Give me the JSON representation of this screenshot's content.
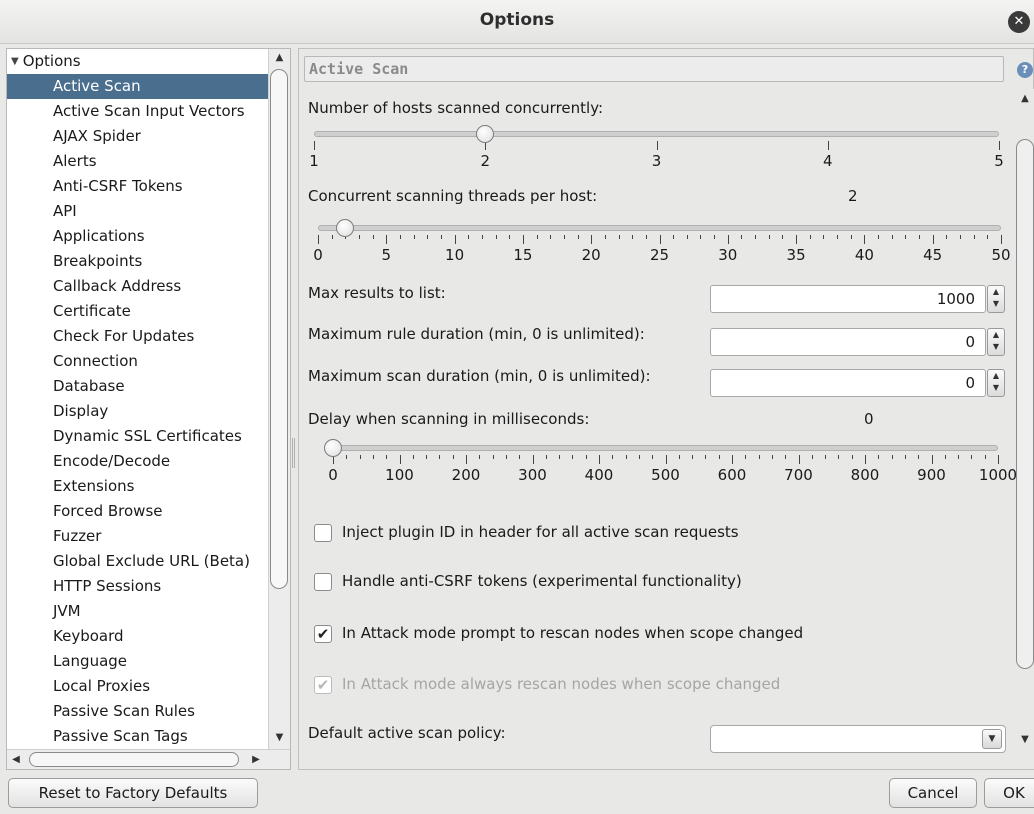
{
  "window": {
    "title": "Options",
    "close_icon": "close-icon"
  },
  "tree": {
    "root_label": "Options",
    "items": [
      "Active Scan",
      "Active Scan Input Vectors",
      "AJAX Spider",
      "Alerts",
      "Anti-CSRF Tokens",
      "API",
      "Applications",
      "Breakpoints",
      "Callback Address",
      "Certificate",
      "Check For Updates",
      "Connection",
      "Database",
      "Display",
      "Dynamic SSL Certificates",
      "Encode/Decode",
      "Extensions",
      "Forced Browse",
      "Fuzzer",
      "Global Exclude URL (Beta)",
      "HTTP Sessions",
      "JVM",
      "Keyboard",
      "Language",
      "Local Proxies",
      "Passive Scan Rules",
      "Passive Scan Tags"
    ],
    "selected_index": 0
  },
  "panel": {
    "header": "Active Scan",
    "hosts": {
      "label": "Number of hosts scanned concurrently:",
      "value": 2,
      "min": 1,
      "max": 5,
      "tick_labels": [
        "1",
        "2",
        "3",
        "4",
        "5"
      ]
    },
    "threads": {
      "label": "Concurrent scanning threads per host:",
      "value_text": "2",
      "value": 2,
      "min": 0,
      "max": 50,
      "tick_labels": [
        "0",
        "5",
        "10",
        "15",
        "20",
        "25",
        "30",
        "35",
        "40",
        "45",
        "50"
      ]
    },
    "max_results": {
      "label": "Max results to list:",
      "value": "1000"
    },
    "max_rule_duration": {
      "label": "Maximum rule duration (min, 0 is unlimited):",
      "value": "0"
    },
    "max_scan_duration": {
      "label": "Maximum scan duration (min, 0 is unlimited):",
      "value": "0"
    },
    "delay": {
      "label": "Delay when scanning in milliseconds:",
      "value_text": "0",
      "value": 0,
      "min": 0,
      "max": 1000,
      "tick_labels": [
        "0",
        "100",
        "200",
        "300",
        "400",
        "500",
        "600",
        "700",
        "800",
        "900",
        "1000"
      ]
    },
    "checkboxes": [
      {
        "label": "Inject plugin ID in header for all active scan requests",
        "checked": false,
        "enabled": true
      },
      {
        "label": "Handle anti-CSRF tokens (experimental functionality)",
        "checked": false,
        "enabled": true
      },
      {
        "label": "In Attack mode prompt to rescan nodes when scope changed",
        "checked": true,
        "enabled": true
      },
      {
        "label": "In Attack mode always rescan nodes when scope changed",
        "checked": true,
        "enabled": false
      }
    ],
    "policy": {
      "label": "Default active scan policy:",
      "value": ""
    }
  },
  "buttons": {
    "reset": "Reset to Factory Defaults",
    "cancel": "Cancel",
    "ok": "OK"
  }
}
